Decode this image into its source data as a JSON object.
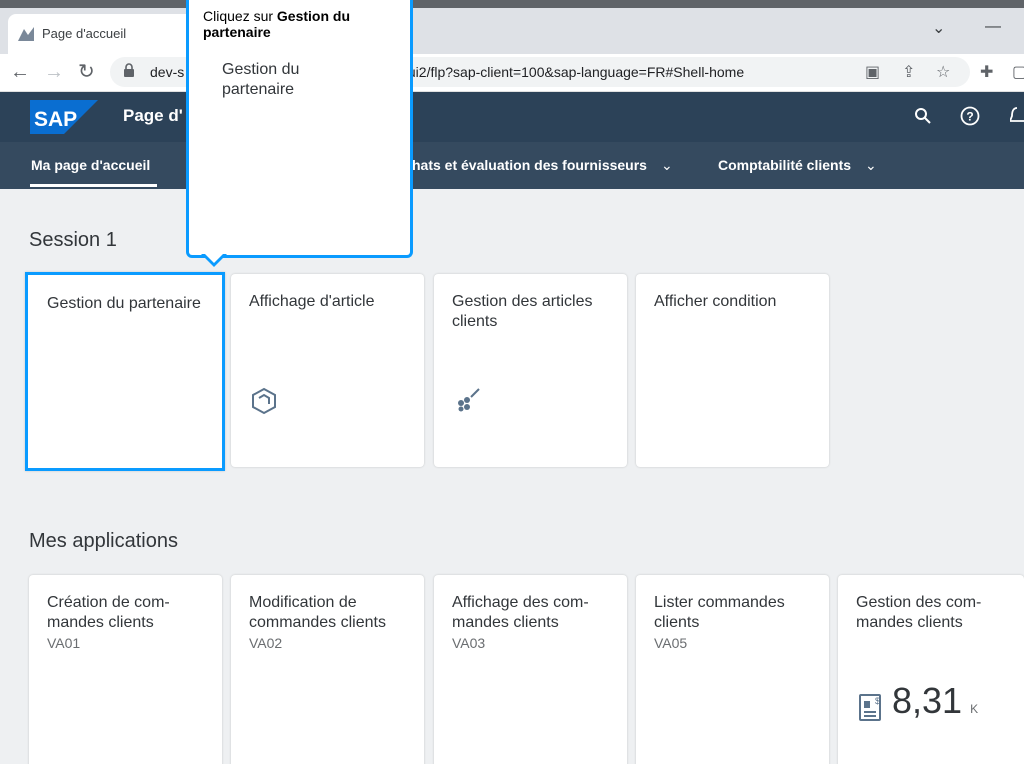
{
  "browser": {
    "tab_title": "Page d'accueil",
    "url_left": "dev-s",
    "url_right": "c/ui2/flp?sap-client=100&sap-language=FR#Shell-home",
    "minimize": "—",
    "dropdown": "⌄"
  },
  "shell": {
    "logo": "SAP",
    "title": "Page d'"
  },
  "nav": {
    "tabs": [
      {
        "label": "Ma page d'accueil"
      },
      {
        "label": "hats et évaluation des fournisseurs"
      },
      {
        "label": "Comptabilité clients"
      }
    ]
  },
  "popover": {
    "instruction_prefix": "Cliquez sur ",
    "instruction_target": "Gestion du partenaire",
    "preview_title": "Gestion du partenaire"
  },
  "sections": {
    "session": {
      "title": "Session 1",
      "tiles": [
        {
          "title": "Gestion du partenaire"
        },
        {
          "title": "Affichage d'article"
        },
        {
          "title": "Gestion des articles clients"
        },
        {
          "title": "Afficher condition"
        }
      ]
    },
    "apps": {
      "title": "Mes applications",
      "tiles": [
        {
          "title": "Création de com-mandes clients",
          "sub": "VA01"
        },
        {
          "title": "Modification de commandes clients",
          "sub": "VA02"
        },
        {
          "title": "Affichage des com-mandes clients",
          "sub": "VA03"
        },
        {
          "title": "Lister commandes clients",
          "sub": "VA05"
        },
        {
          "title": "Gestion des com-mandes clients",
          "kpi_value": "8,31",
          "kpi_unit": "K"
        }
      ]
    }
  },
  "colors": {
    "shell_bar": "#2c4258",
    "nav_bar": "#354a5f",
    "highlight": "#0a9bff",
    "sap_blue": "#0a6ed1"
  }
}
